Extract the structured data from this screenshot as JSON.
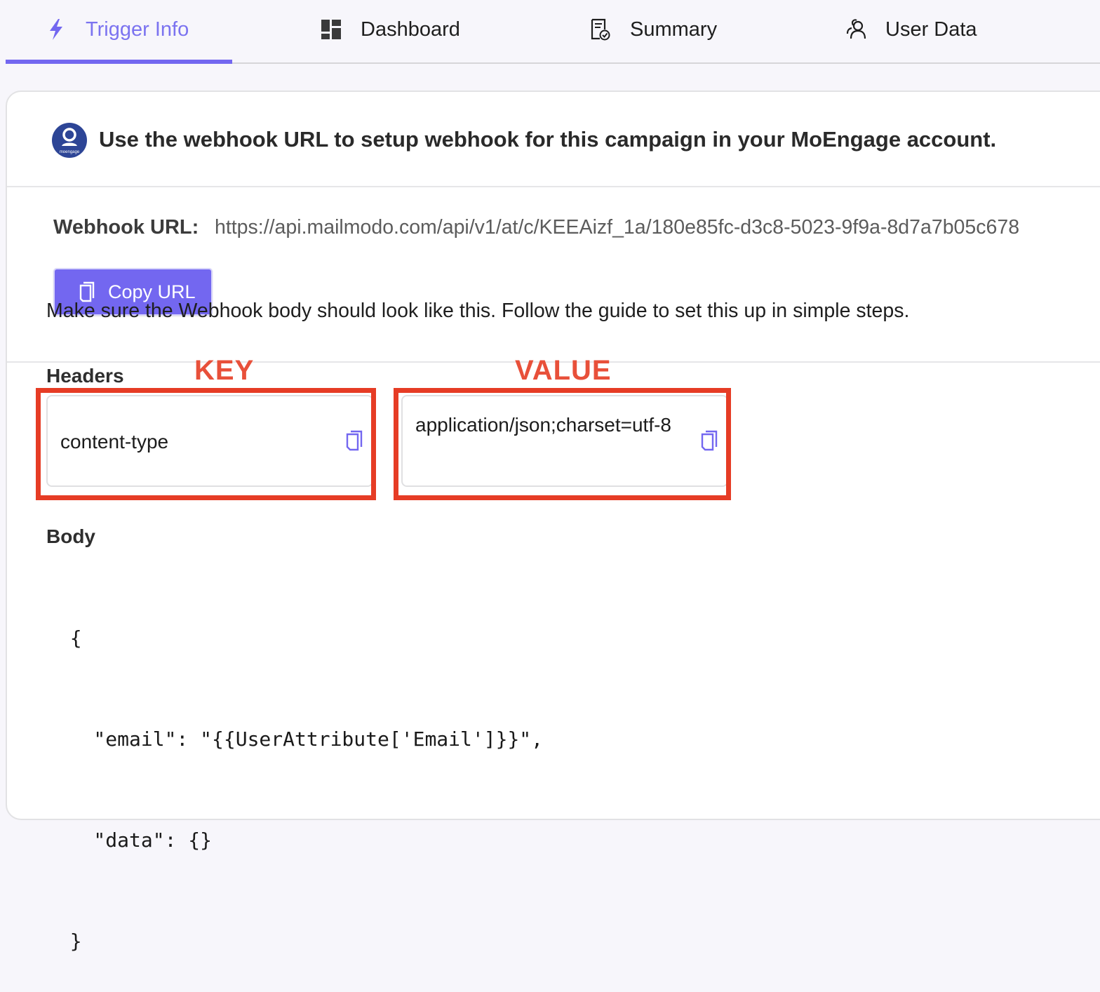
{
  "tabs": [
    {
      "label": "Trigger Info",
      "icon": "lightning-icon",
      "active": true
    },
    {
      "label": "Dashboard",
      "icon": "dashboard-icon",
      "active": false
    },
    {
      "label": "Summary",
      "icon": "summary-document-icon",
      "active": false
    },
    {
      "label": "User Data",
      "icon": "users-icon",
      "active": false
    }
  ],
  "header": {
    "logo": "moengage-logo",
    "logo_text": "moengage",
    "message": "Use the webhook URL to setup webhook for this campaign in your MoEngage account."
  },
  "webhook": {
    "label": "Webhook URL:",
    "url": "https://api.mailmodo.com/api/v1/at/c/KEEAizf_1a/180e85fc-d3c8-5023-9f9a-8d7a7b05c678",
    "copy_button": "Copy URL"
  },
  "guide_text": "Make sure the Webhook body should look like this. Follow the guide to set this up in simple steps.",
  "headers": {
    "label": "Headers",
    "key": "content-type",
    "value": "application/json;charset=utf-8"
  },
  "annotations": {
    "key_label": "KEY",
    "value_label": "VALUE",
    "color": "#e63c25"
  },
  "body": {
    "label": "Body",
    "code_lines": [
      "  {",
      "    \"email\": \"{{UserAttribute['Email']}}\",",
      "    \"data\": {}",
      "  }"
    ]
  },
  "colors": {
    "accent": "#7367f0",
    "annotation": "#e63c25"
  }
}
